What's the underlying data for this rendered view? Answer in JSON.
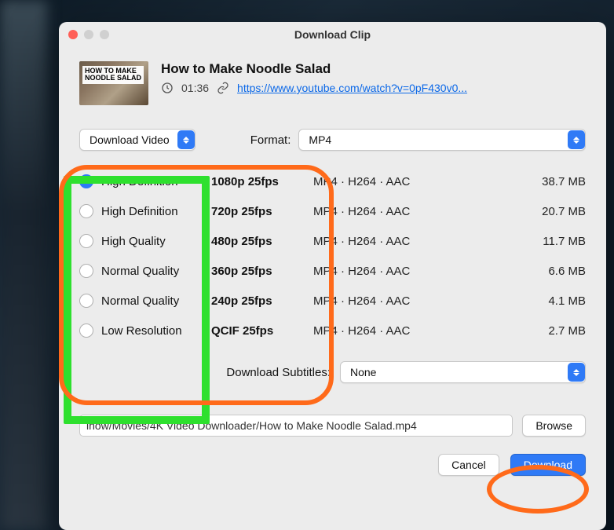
{
  "window": {
    "title": "Download Clip"
  },
  "clip": {
    "thumb_caption": "HOW TO MAKE\nNOODLE SALAD",
    "title": "How to Make Noodle Salad",
    "duration": "01:36",
    "url_display": "https://www.youtube.com/watch?v=0pF430v0..."
  },
  "controls": {
    "download_mode": "Download Video",
    "format_label": "Format:",
    "format_value": "MP4"
  },
  "qualities": [
    {
      "selected": true,
      "label": "High Definition",
      "res": "1080p 25fps",
      "codec": "MP4 · H264 · AAC",
      "size": "38.7 MB"
    },
    {
      "selected": false,
      "label": "High Definition",
      "res": "720p 25fps",
      "codec": "MP4 · H264 · AAC",
      "size": "20.7 MB"
    },
    {
      "selected": false,
      "label": "High Quality",
      "res": "480p 25fps",
      "codec": "MP4 · H264 · AAC",
      "size": "11.7 MB"
    },
    {
      "selected": false,
      "label": "Normal Quality",
      "res": "360p 25fps",
      "codec": "MP4 · H264 · AAC",
      "size": "6.6 MB"
    },
    {
      "selected": false,
      "label": "Normal Quality",
      "res": "240p 25fps",
      "codec": "MP4 · H264 · AAC",
      "size": "4.1 MB"
    },
    {
      "selected": false,
      "label": "Low Resolution",
      "res": "QCIF 25fps",
      "codec": "MP4 · H264 · AAC",
      "size": "2.7 MB"
    }
  ],
  "subtitles": {
    "label": "Download Subtitles:",
    "value": "None"
  },
  "path": {
    "value": "ihow/Movies/4K Video Downloader/How to Make Noodle Salad.mp4",
    "browse": "Browse"
  },
  "actions": {
    "cancel": "Cancel",
    "download": "Download"
  }
}
